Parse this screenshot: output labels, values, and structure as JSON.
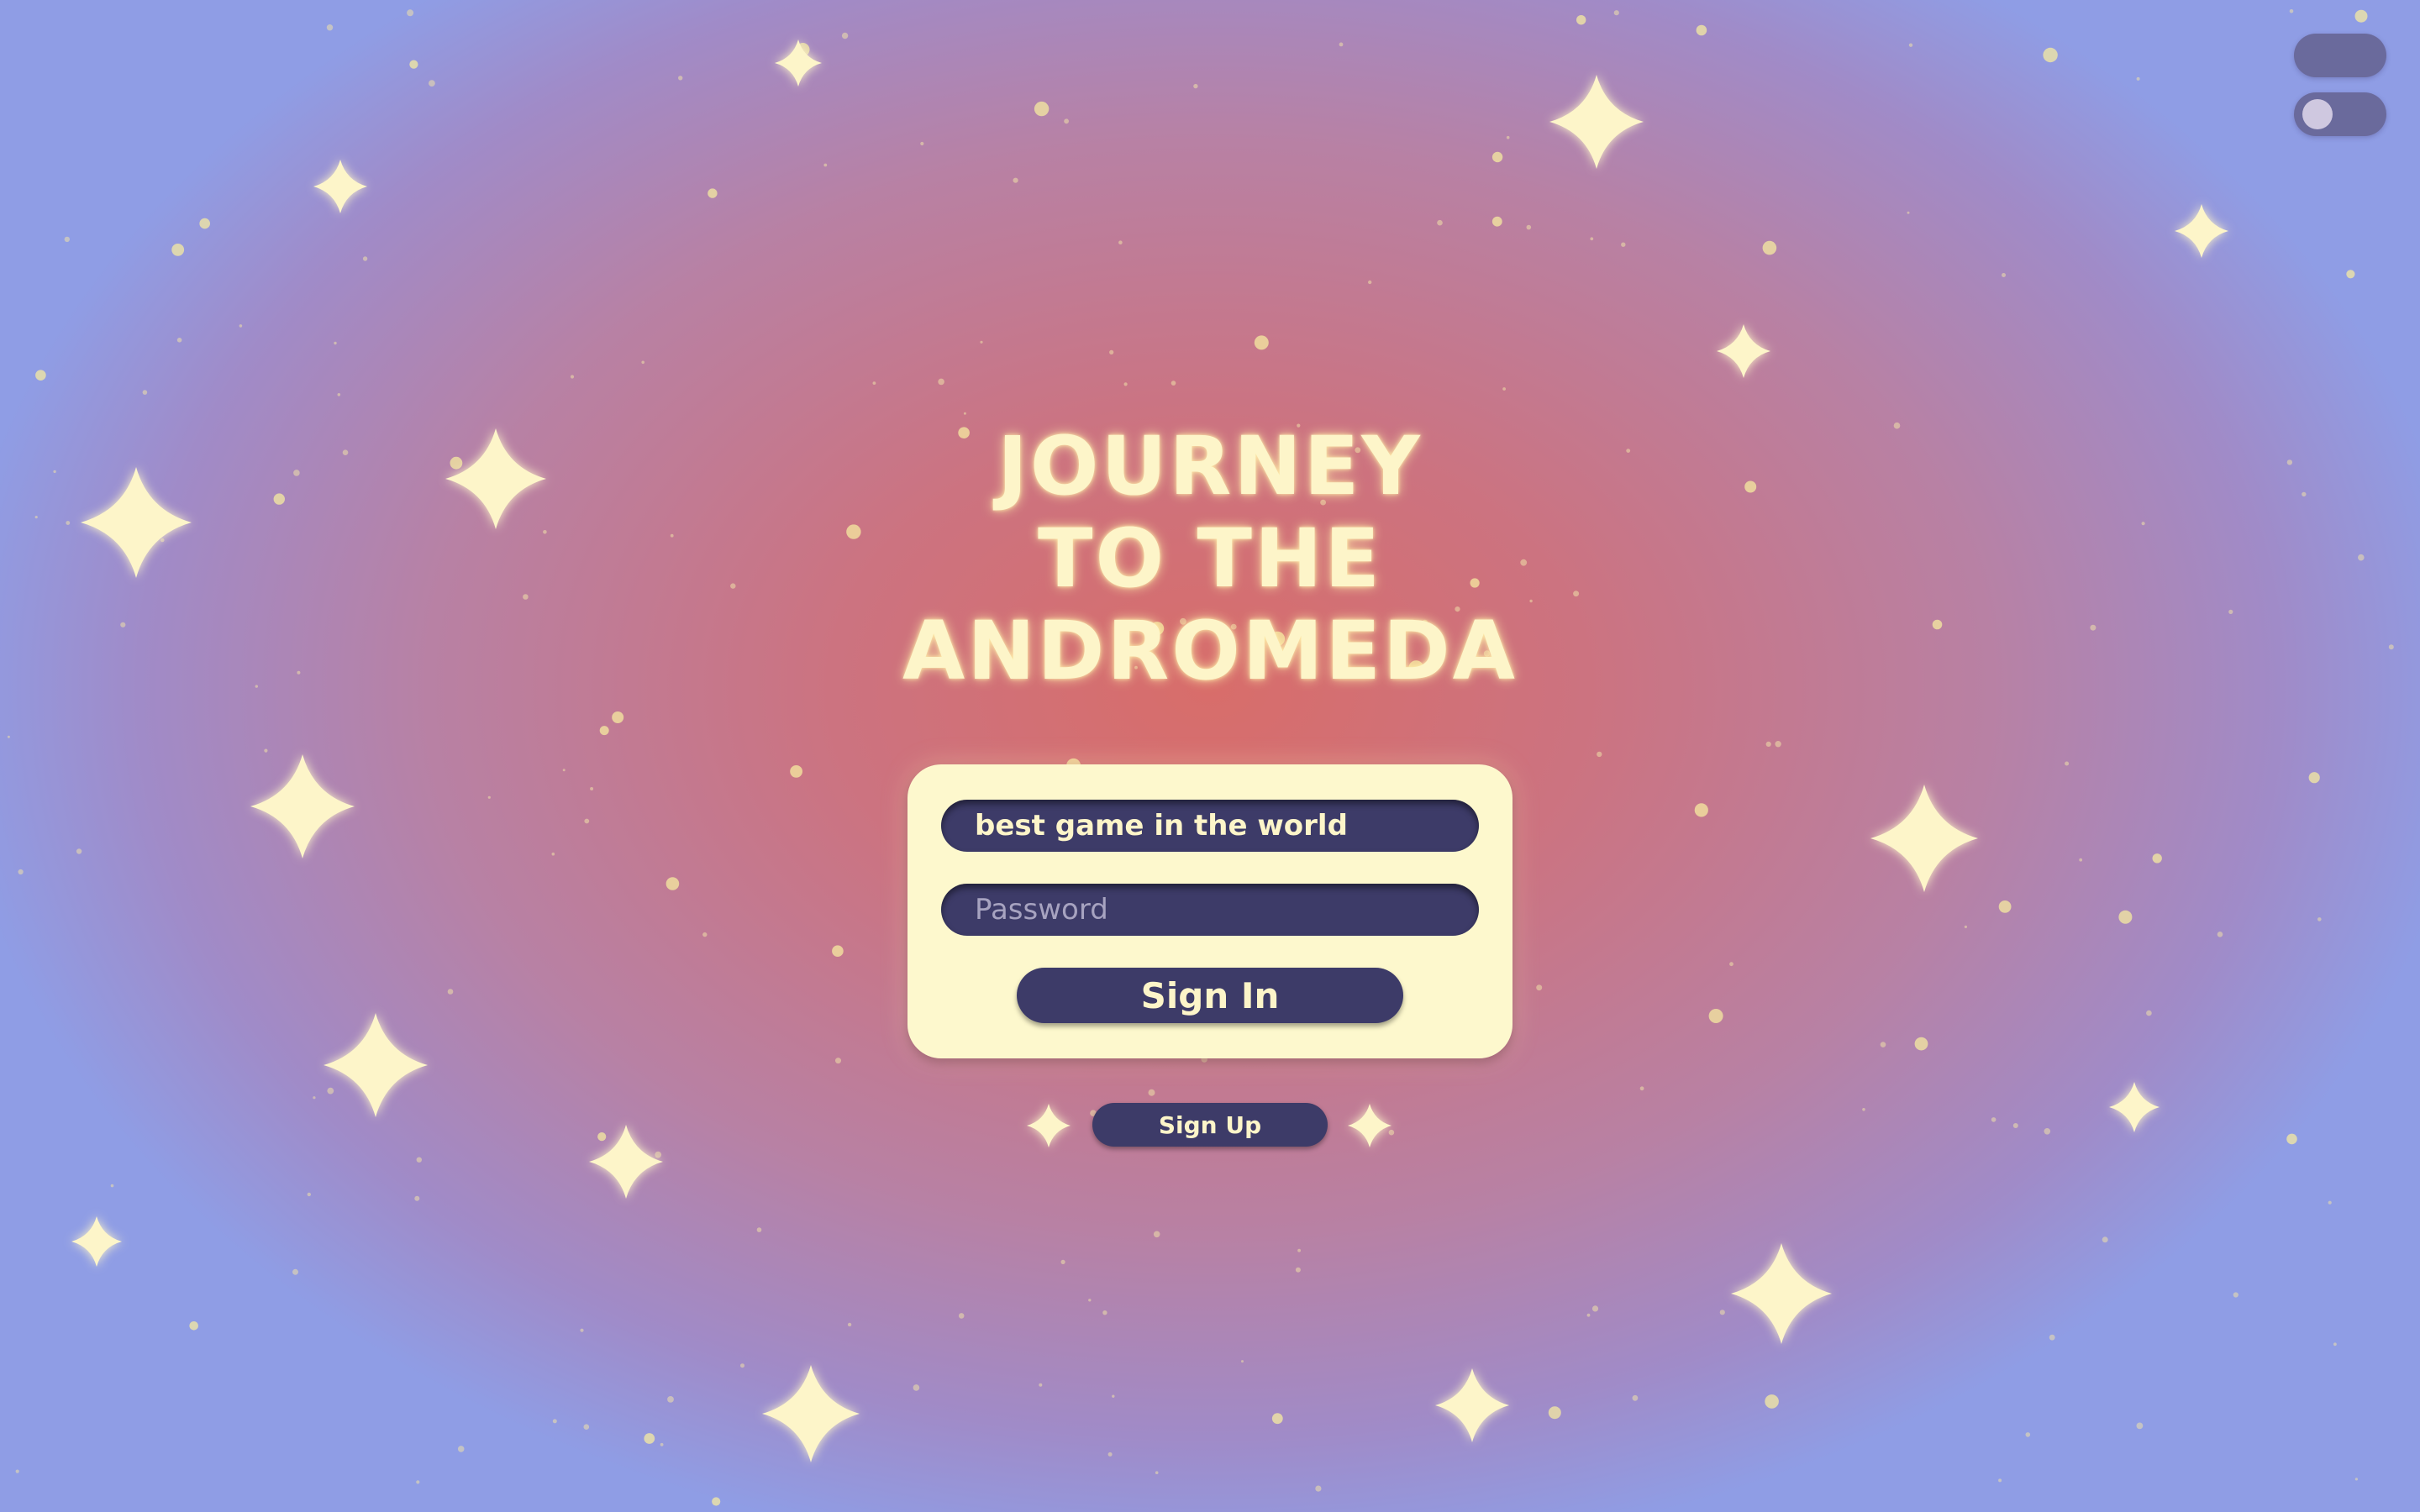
{
  "app": {
    "title_lines": [
      "JOURNEY",
      "TO THE",
      "ANDROMEDA"
    ]
  },
  "login": {
    "username_value": "best game in the world",
    "password_placeholder": "Password",
    "signin_label": "Sign In",
    "signup_label": "Sign Up"
  },
  "colors": {
    "accent_navy": "#3d3b68",
    "card_cream": "#fdf8cd",
    "title_glow": "#fdf5c9",
    "toggle_track": "#6a6a9c"
  },
  "icons": {
    "sparkle": "sparkle-icon"
  }
}
